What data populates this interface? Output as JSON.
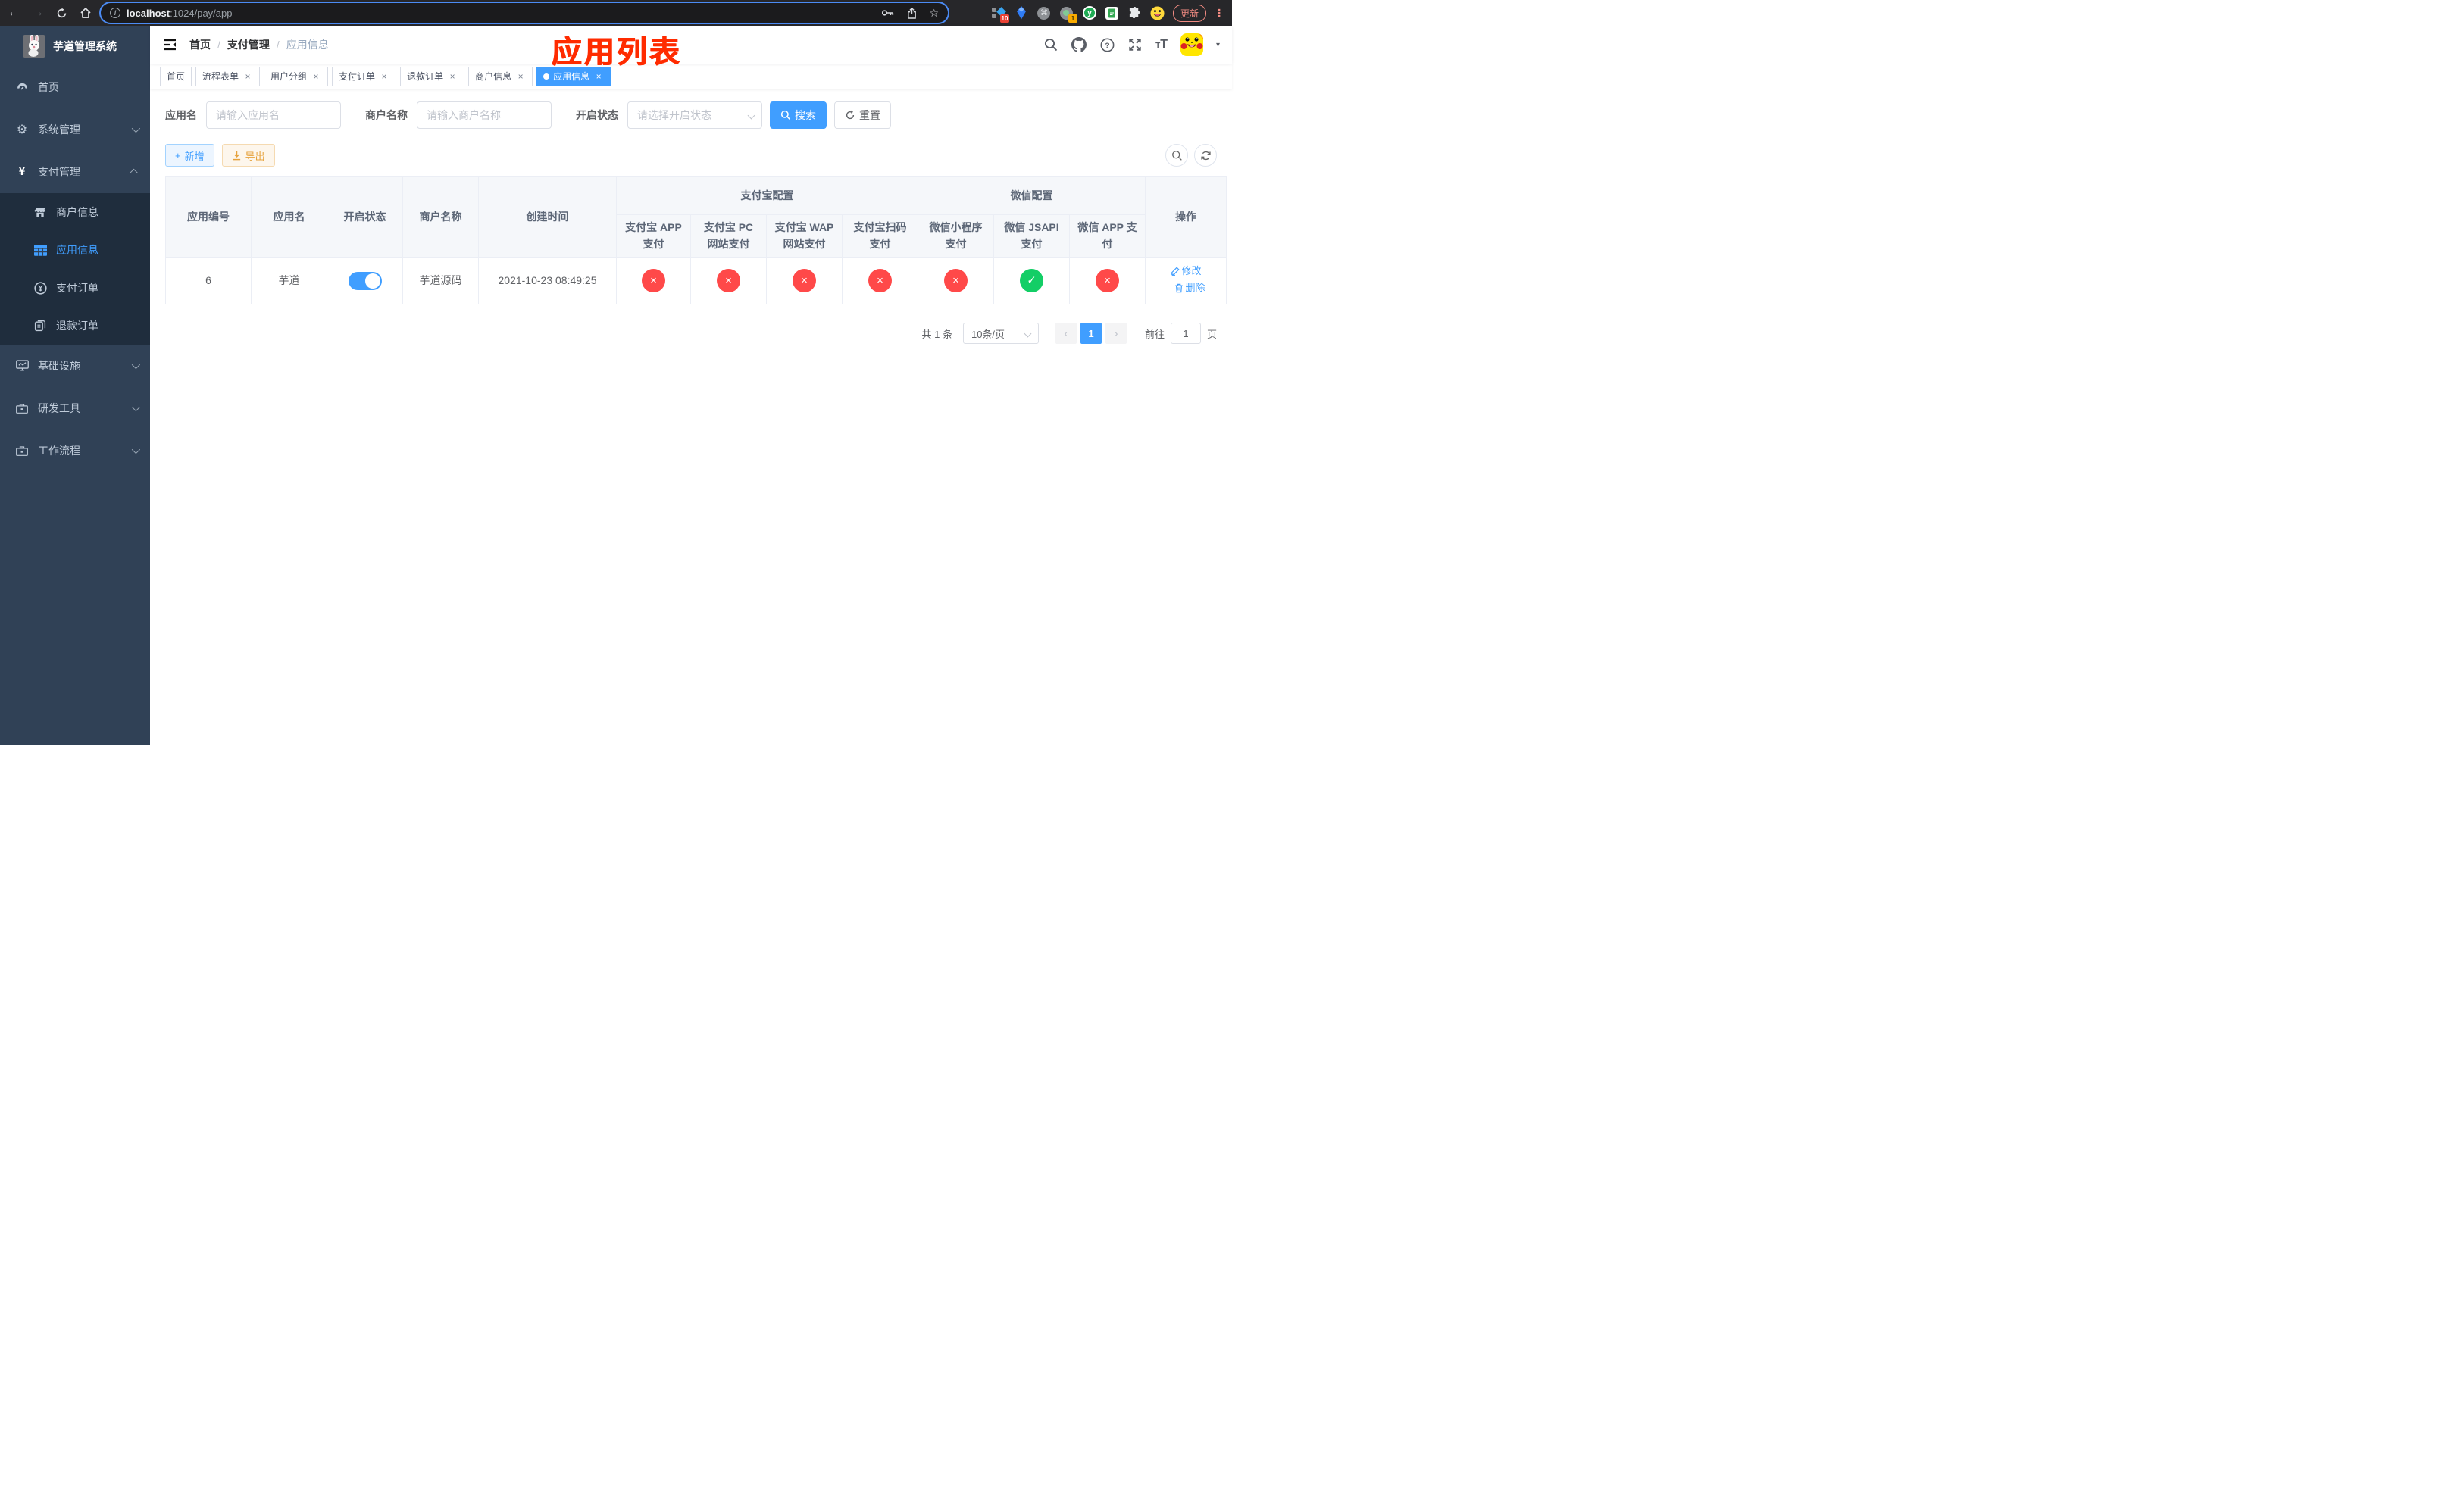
{
  "browser": {
    "url_host": "localhost",
    "url_rest": ":1024/pay/app",
    "update_label": "更新",
    "ext_badge_10": "10",
    "ext_badge_1": "1",
    "ext_y_letter": "y"
  },
  "icons": {
    "back": "←",
    "forward": "→",
    "star": "☆",
    "command": "⌘",
    "overflow_menu": "⋮",
    "info": "i",
    "close": "×",
    "plus": "+",
    "prev": "‹",
    "next": "›",
    "caret": "▾",
    "gear": "⚙",
    "yen": "¥",
    "check": "✓",
    "cross": "×",
    "font_small": "T",
    "font_large": "T"
  },
  "sidebar": {
    "title": "芋道管理系统",
    "menu": [
      {
        "label": "首页"
      },
      {
        "label": "系统管理"
      },
      {
        "label": "支付管理"
      },
      {
        "label": "商户信息"
      },
      {
        "label": "应用信息"
      },
      {
        "label": "支付订单"
      },
      {
        "label": "退款订单"
      },
      {
        "label": "基础设施"
      },
      {
        "label": "研发工具"
      },
      {
        "label": "工作流程"
      }
    ]
  },
  "navbar": {
    "breadcrumb": [
      "首页",
      "支付管理",
      "应用信息"
    ],
    "separator": "/",
    "annotation": "应用列表"
  },
  "tags": [
    {
      "label": "首页"
    },
    {
      "label": "流程表单"
    },
    {
      "label": "用户分组"
    },
    {
      "label": "支付订单"
    },
    {
      "label": "退款订单"
    },
    {
      "label": "商户信息"
    },
    {
      "label": "应用信息"
    }
  ],
  "filters": {
    "app_name_label": "应用名",
    "app_name_placeholder": "请输入应用名",
    "merchant_label": "商户名称",
    "merchant_placeholder": "请输入商户名称",
    "status_label": "开启状态",
    "status_placeholder": "请选择开启状态",
    "search_label": "搜索",
    "reset_label": "重置"
  },
  "toolbar": {
    "add_label": "新增",
    "export_label": "导出"
  },
  "table": {
    "group_headers": {
      "alipay": "支付宝配置",
      "wechat": "微信配置"
    },
    "headers": [
      "应用编号",
      "应用名",
      "开启状态",
      "商户名称",
      "创建时间",
      "支付宝 APP 支付",
      "支付宝 PC 网站支付",
      "支付宝 WAP 网站支付",
      "支付宝扫码支付",
      "微信小程序支付",
      "微信 JSAPI 支付",
      "微信 APP 支付",
      "操作"
    ],
    "row": {
      "id": "6",
      "name": "芋道",
      "enabled": true,
      "merchant": "芋道源码",
      "created": "2021-10-23 08:49:25",
      "statuses": [
        "fail",
        "fail",
        "fail",
        "fail",
        "fail",
        "pass",
        "fail"
      ],
      "edit_label": "修改",
      "delete_label": "删除"
    }
  },
  "pagination": {
    "total": "共 1 条",
    "size": "10条/页",
    "page": "1",
    "goto_label": "前往",
    "goto_value": "1",
    "unit": "页"
  },
  "colors": {
    "primary": "#409eff",
    "success": "#13ce66",
    "danger": "#ff4949",
    "warning": "#e6a23c",
    "annotation": "#ff2b00",
    "sidebar_bg": "#304156",
    "submenu_bg": "#1f2d3d"
  }
}
